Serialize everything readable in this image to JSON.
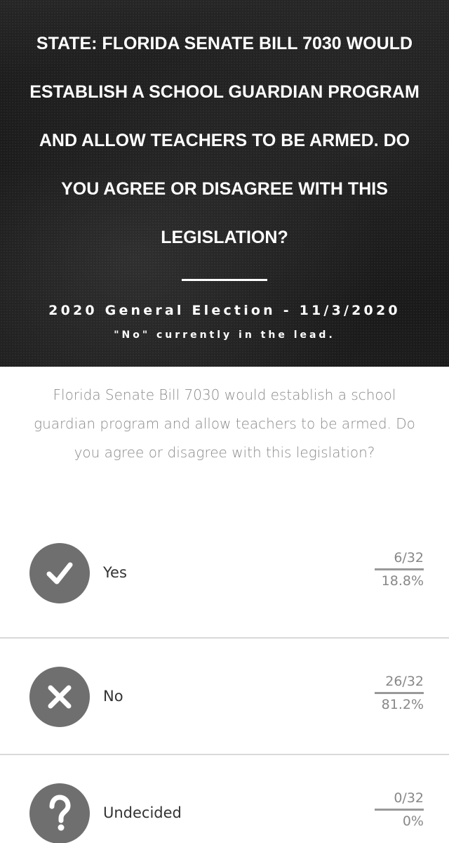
{
  "hero": {
    "title": "State: Florida Senate Bill 7030 would establish a school guardian program and allow teachers to be armed. Do you agree or disagree with this legislation?",
    "election": "2020 General Election - 11/3/2020",
    "status": "\"No\" currently in the lead."
  },
  "question": "Florida Senate Bill 7030 would establish a school guardian program and allow teachers to be armed. Do you agree or disagree with this legislation?",
  "options": [
    {
      "label": "Yes",
      "count": "6/32",
      "percent": "18.8%",
      "icon": "check-icon"
    },
    {
      "label": "No",
      "count": "26/32",
      "percent": "81.2%",
      "icon": "x-icon"
    },
    {
      "label": "Undecided",
      "count": "0/32",
      "percent": "0%",
      "icon": "question-icon"
    }
  ],
  "colors": {
    "icon_bg": "#6f6f6f",
    "question_text": "#8a8a8a",
    "hero_bg": "#1a1a1a"
  }
}
